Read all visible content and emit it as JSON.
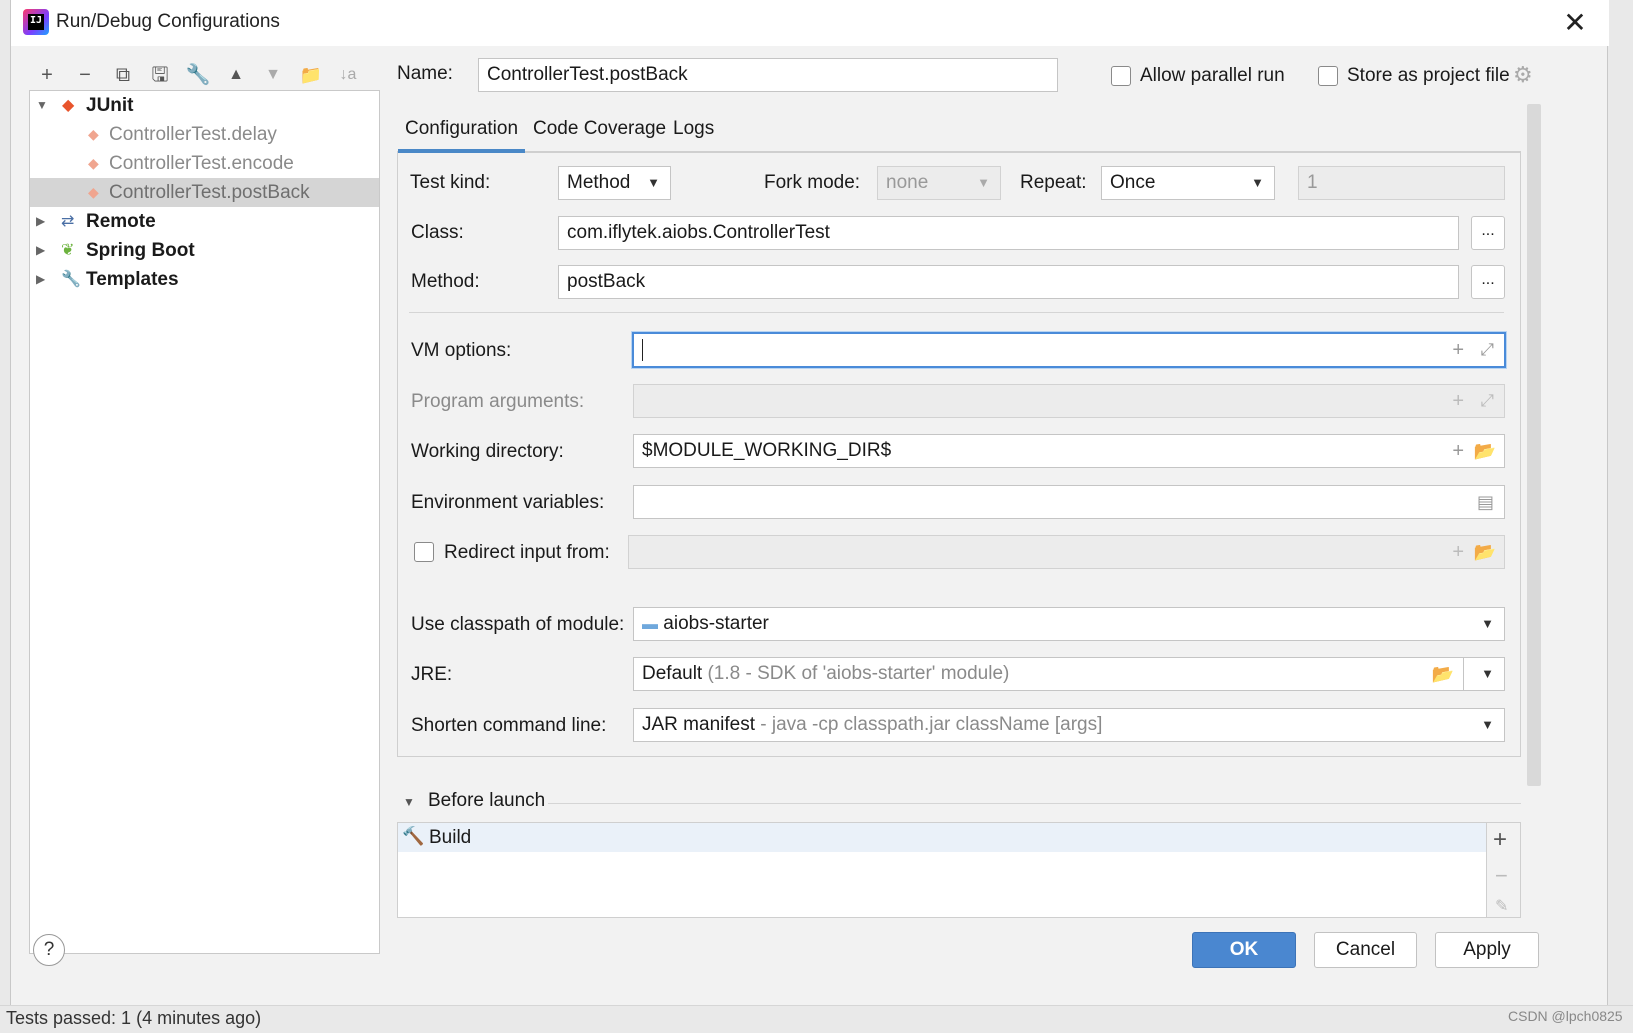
{
  "window": {
    "title": "Run/Debug Configurations",
    "app_icon_text": "IJ"
  },
  "background": {
    "status_text": "Tests passed: 1 (4 minutes ago)",
    "watermark": "CSDN @lpch0825"
  },
  "toolbar": {
    "add": "+",
    "remove": "−",
    "copy": "⧉",
    "save": "🖫",
    "edit_defaults": "🔧",
    "move_up": "▲",
    "move_down": "▼",
    "new_folder": "📁",
    "sort": "↓a"
  },
  "tree": {
    "junit": {
      "label": "JUnit",
      "expanded": true
    },
    "junit_children": [
      {
        "label": "ControllerTest.delay",
        "selected": false
      },
      {
        "label": "ControllerTest.encode",
        "selected": false
      },
      {
        "label": "ControllerTest.postBack",
        "selected": true
      }
    ],
    "remote": {
      "label": "Remote"
    },
    "spring_boot": {
      "label": "Spring Boot"
    },
    "templates": {
      "label": "Templates"
    }
  },
  "header": {
    "name_label": "Name:",
    "name_value": "ControllerTest.postBack",
    "allow_parallel_label": "Allow parallel run",
    "allow_parallel_checked": false,
    "store_project_label": "Store as project file",
    "store_project_checked": false
  },
  "tabs": [
    {
      "label": "Configuration",
      "active": true
    },
    {
      "label": "Code Coverage",
      "active": false
    },
    {
      "label": "Logs",
      "active": false
    }
  ],
  "config": {
    "test_kind_label": "Test kind:",
    "test_kind_value": "Method",
    "fork_mode_label": "Fork mode:",
    "fork_mode_value": "none",
    "repeat_label": "Repeat:",
    "repeat_value": "Once",
    "repeat_count": "1",
    "class_label": "Class:",
    "class_value": "com.iflytek.aiobs.ControllerTest",
    "method_label": "Method:",
    "method_value": "postBack",
    "browse_label": "...",
    "vm_options_label": "VM options:",
    "vm_options_value": "",
    "program_args_label": "Program arguments:",
    "program_args_value": "",
    "working_dir_label": "Working directory:",
    "working_dir_value": "$MODULE_WORKING_DIR$",
    "env_vars_label": "Environment variables:",
    "env_vars_value": "",
    "redirect_label": "Redirect input from:",
    "redirect_checked": false,
    "redirect_value": "",
    "classpath_label": "Use classpath of module:",
    "classpath_value": "aiobs-starter",
    "jre_label": "JRE:",
    "jre_value": "Default",
    "jre_hint": "(1.8 - SDK of 'aiobs-starter' module)",
    "shorten_label": "Shorten command line:",
    "shorten_value": "JAR manifest",
    "shorten_hint": "- java -cp classpath.jar className [args]"
  },
  "before_launch": {
    "label": "Before launch",
    "items": [
      {
        "label": "Build"
      }
    ]
  },
  "buttons": {
    "ok": "OK",
    "cancel": "Cancel",
    "apply": "Apply",
    "help": "?"
  },
  "colors": {
    "accent": "#4a87d0",
    "junit_icon": "#e8542c",
    "spring_icon": "#6db33f",
    "build_icon": "#4a9a3b"
  }
}
